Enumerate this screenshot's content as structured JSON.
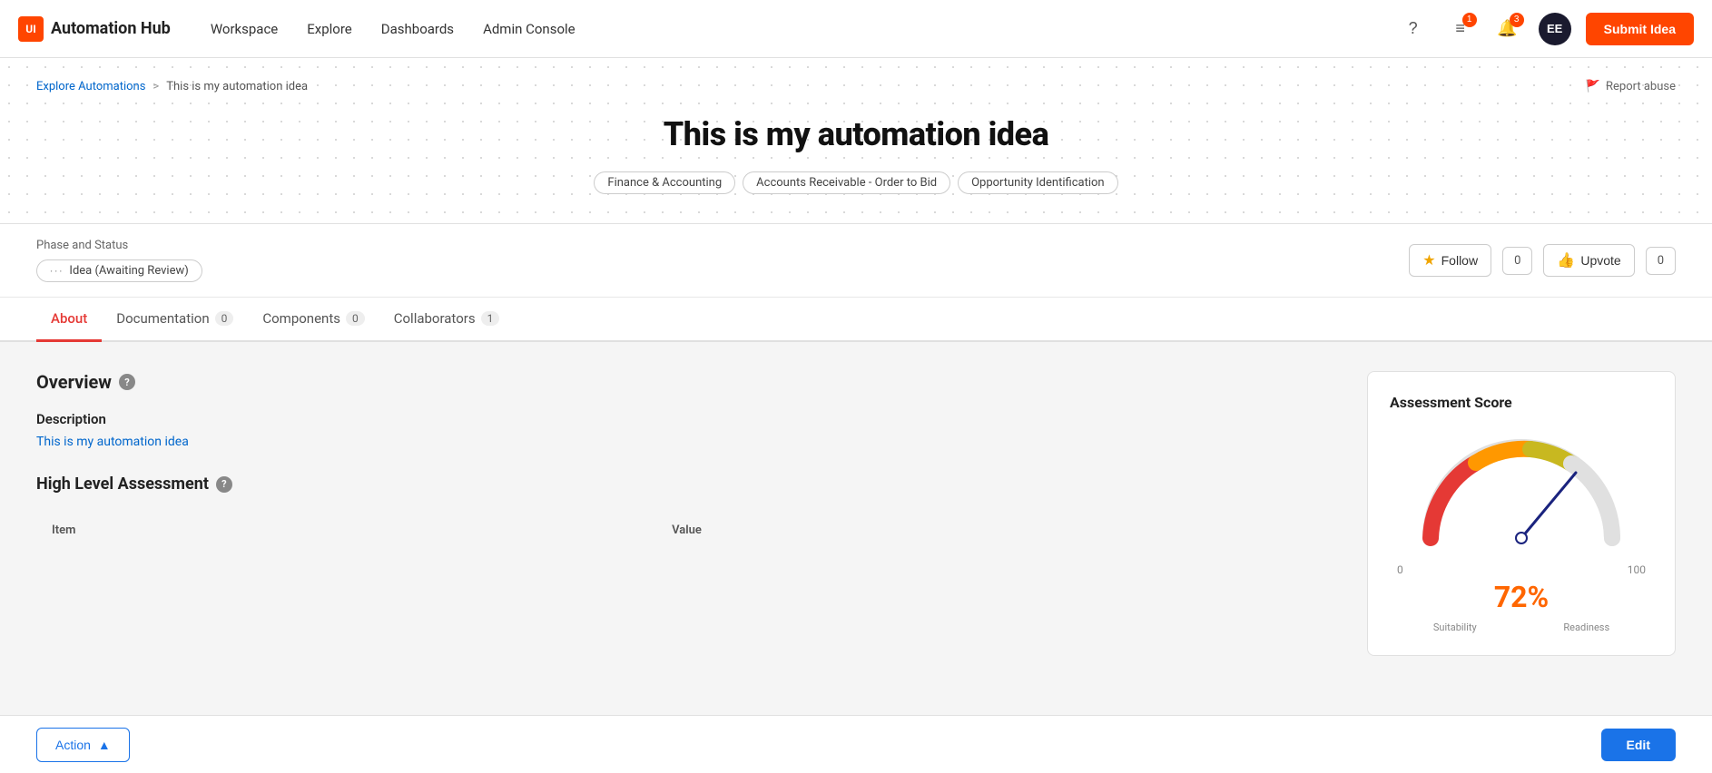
{
  "brand": {
    "icon_text": "UI",
    "name": "Automation Hub"
  },
  "nav": {
    "links": [
      "Workspace",
      "Explore",
      "Dashboards",
      "Admin Console"
    ]
  },
  "header": {
    "notifications_1_count": "1",
    "notifications_2_count": "3",
    "avatar_initials": "EE",
    "submit_label": "Submit Idea"
  },
  "breadcrumb": {
    "parent": "Explore Automations",
    "separator": ">",
    "current": "This is my automation idea"
  },
  "report_abuse": "Report abuse",
  "page": {
    "title": "This is my automation idea",
    "tags": [
      "Finance & Accounting",
      "Accounts Receivable - Order to Bid",
      "Opportunity Identification"
    ]
  },
  "phase": {
    "label": "Phase and Status",
    "badge": "Idea (Awaiting Review)",
    "dots": "···"
  },
  "actions": {
    "follow_label": "Follow",
    "follow_count": "0",
    "upvote_label": "Upvote",
    "upvote_count": "0"
  },
  "tabs": [
    {
      "id": "about",
      "label": "About",
      "count": null,
      "active": true
    },
    {
      "id": "documentation",
      "label": "Documentation",
      "count": "0",
      "active": false
    },
    {
      "id": "components",
      "label": "Components",
      "count": "0",
      "active": false
    },
    {
      "id": "collaborators",
      "label": "Collaborators",
      "count": "1",
      "active": false
    }
  ],
  "overview": {
    "title": "Overview",
    "description_label": "Description",
    "description_text": "This is my automation idea"
  },
  "high_level_assessment": {
    "title": "High Level Assessment",
    "table": {
      "columns": [
        "Item",
        "Value"
      ]
    }
  },
  "assessment_score": {
    "title": "Assessment Score",
    "percent": "72%",
    "gauge_min": "0",
    "gauge_max": "100",
    "sublabels": [
      "Suitability",
      "Readiness"
    ]
  },
  "bottom_bar": {
    "action_label": "Action",
    "edit_label": "Edit"
  }
}
